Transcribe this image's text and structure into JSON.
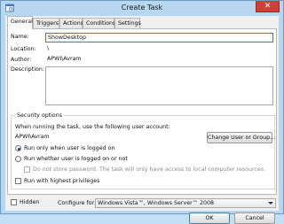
{
  "window": {
    "title": "Create Task",
    "close_symbol": "✕"
  },
  "tabs": [
    {
      "label": "General"
    },
    {
      "label": "Triggers"
    },
    {
      "label": "Actions"
    },
    {
      "label": "Conditions"
    },
    {
      "label": "Settings"
    }
  ],
  "general": {
    "name_label": "Name:",
    "name_value": "ShowDesktop",
    "location_label": "Location:",
    "location_value": "\\",
    "author_label": "Author:",
    "author_value": "APWI\\Avram",
    "description_label": "Description:",
    "description_value": ""
  },
  "security": {
    "group_title": "Security options",
    "prompt": "When running the task, use the following user account:",
    "account": "APWI\\Avram",
    "change_button": "Change User or Group...",
    "radio_logged_on": "Run only when user is logged on",
    "radio_any": "Run whether user is logged on or not",
    "no_store_password": "Do not store password.  The task will only have access to local computer resources.",
    "highest_privileges": "Run with highest privileges"
  },
  "footer": {
    "hidden_label": "Hidden",
    "configure_label": "Configure for:",
    "configure_value": "Windows Vista™, Windows Server™ 2008",
    "ok_button": "OK",
    "cancel_button": "Cancel"
  },
  "colors": {
    "titlebar": "#b6d7ef",
    "close": "#c7423a",
    "focus_border": "#3c7fb1"
  }
}
